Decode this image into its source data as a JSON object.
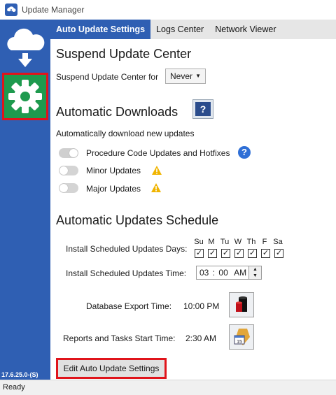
{
  "window": {
    "title": "Update Manager"
  },
  "tabs": [
    {
      "label": "Auto Update Settings",
      "active": true
    },
    {
      "label": "Logs Center",
      "active": false
    },
    {
      "label": "Network Viewer",
      "active": false
    }
  ],
  "sidebar": {
    "version": "17.6.25.0-(S)"
  },
  "suspend": {
    "heading": "Suspend Update Center",
    "label": "Suspend Update Center for",
    "value": "Never"
  },
  "downloads": {
    "heading": "Automatic Downloads",
    "description": "Automatically download new updates",
    "items": [
      {
        "label": "Procedure Code Updates and Hotfixes",
        "enabled": true
      },
      {
        "label": "Minor Updates",
        "enabled": false
      },
      {
        "label": "Major Updates",
        "enabled": false
      }
    ]
  },
  "schedule": {
    "heading": "Automatic Updates Schedule",
    "days_label": "Install Scheduled Updates Days:",
    "days": [
      {
        "label": "Su",
        "checked": true
      },
      {
        "label": "M",
        "checked": true
      },
      {
        "label": "Tu",
        "checked": true
      },
      {
        "label": "W",
        "checked": true
      },
      {
        "label": "Th",
        "checked": true
      },
      {
        "label": "F",
        "checked": true
      },
      {
        "label": "Sa",
        "checked": true
      }
    ],
    "time_label": "Install Scheduled Updates Time:",
    "time_hour": "03",
    "time_minute": "00",
    "time_ampm": "AM",
    "export_label": "Database Export Time:",
    "export_time": "10:00 PM",
    "reports_label": "Reports and Tasks Start Time:",
    "reports_time": "2:30 AM"
  },
  "edit_button": "Edit Auto Update Settings",
  "status": "Ready",
  "colors": {
    "sidebar": "#2f5fb3",
    "highlight": "#e0141b",
    "settings_bg": "#1e9a4e",
    "warning": "#f0b400"
  }
}
